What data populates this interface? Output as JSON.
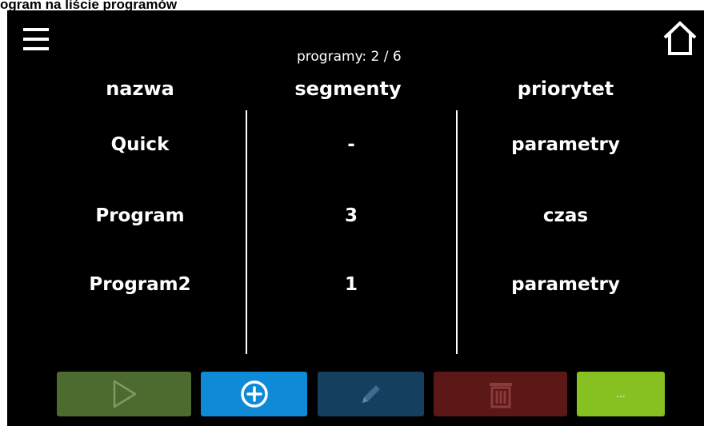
{
  "caption": "ogram na liście programów",
  "header": {
    "menu_icon": "hamburger-menu-icon",
    "home_icon": "home-icon",
    "counter_label": "programy:",
    "counter_value": "2 / 6"
  },
  "table": {
    "columns": [
      "nazwa",
      "segmenty",
      "priorytet"
    ],
    "rows": [
      {
        "name": "Quick",
        "segments": "-",
        "priority": "parametry"
      },
      {
        "name": "Program",
        "segments": "3",
        "priority": "czas"
      },
      {
        "name": "Program2",
        "segments": "1",
        "priority": "parametry"
      }
    ]
  },
  "toolbar": {
    "play": {
      "icon": "play-icon",
      "color": "#4c6b2e"
    },
    "add": {
      "icon": "plus-circle-icon",
      "color": "#0e8ad6"
    },
    "edit": {
      "icon": "pencil-icon",
      "color": "#143f5e"
    },
    "delete": {
      "icon": "trash-icon",
      "color": "#5c1717"
    },
    "more": {
      "label": "...",
      "color": "#86c121"
    }
  }
}
